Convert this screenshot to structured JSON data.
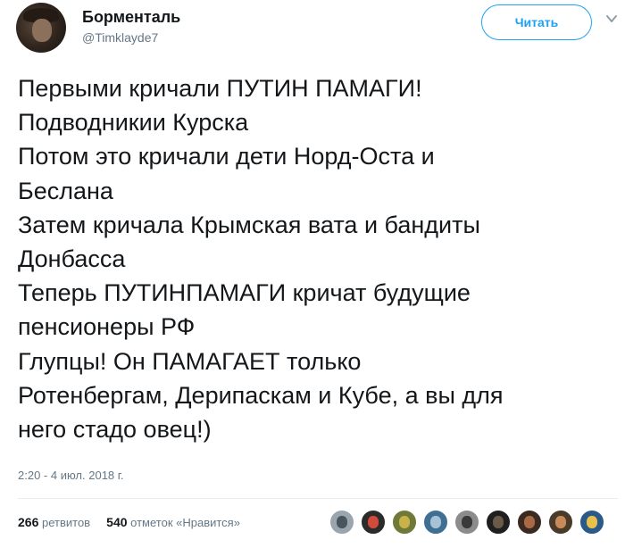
{
  "author": {
    "display_name": "Борменталь",
    "handle": "@Timklayde7",
    "avatar_icon": "profile-avatar"
  },
  "header": {
    "follow_label": "Читать",
    "more_icon": "chevron-down-icon",
    "accent": "#1da1f2"
  },
  "tweet": {
    "lines": [
      "Первыми кричали ПУТИН ПАМАГИ!",
      "Подводникии Курска",
      "Потом это кричали дети Норд-Оста и",
      "Беслана",
      "Затем кричала Крымская вата и бандиты",
      "Донбасса",
      "Теперь ПУТИНПАМАГИ кричат будущие",
      "пенсионеры РФ",
      "Глупцы! Он ПАМАГАЕТ только",
      "Ротенбергам, Дерипаскам и Кубе, а вы для",
      "него стадо овец!)"
    ],
    "timestamp": "2:20 - 4 июл. 2018 г."
  },
  "stats": {
    "retweets_count": "266",
    "retweets_label": "ретвитов",
    "likes_count": "540",
    "likes_label": "отметок «Нравится»"
  },
  "likers": [
    {
      "name": "liker-avatar-1",
      "bg": "#9aa5ad",
      "fg": "#4a545c"
    },
    {
      "name": "liker-avatar-2",
      "bg": "#2b2b2b",
      "fg": "#d24a3a"
    },
    {
      "name": "liker-avatar-3",
      "bg": "#6f7a3a",
      "fg": "#c9b24a"
    },
    {
      "name": "liker-avatar-4",
      "bg": "#3f6f93",
      "fg": "#a9c3d6"
    },
    {
      "name": "liker-avatar-5",
      "bg": "#8c8c8c",
      "fg": "#3a3a3a"
    },
    {
      "name": "liker-avatar-6",
      "bg": "#1f1f1f",
      "fg": "#6a5a4a"
    },
    {
      "name": "liker-avatar-7",
      "bg": "#3a2a22",
      "fg": "#a86a44"
    },
    {
      "name": "liker-avatar-8",
      "bg": "#4a3a2a",
      "fg": "#c98a5a"
    },
    {
      "name": "liker-avatar-9",
      "bg": "#2a5a8a",
      "fg": "#e8c04a"
    }
  ]
}
